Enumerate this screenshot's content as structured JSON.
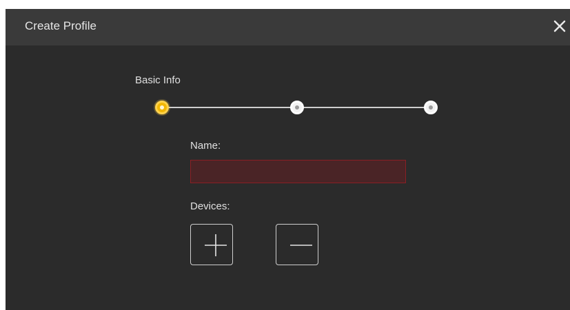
{
  "dialog": {
    "title": "Create Profile",
    "close_icon": "close-icon"
  },
  "stepper": {
    "steps": [
      {
        "label": "Basic Info",
        "state": "active"
      },
      {
        "label": "",
        "state": "inactive"
      },
      {
        "label": "",
        "state": "inactive"
      }
    ],
    "active_color": "#f2b705"
  },
  "form": {
    "name_label": "Name:",
    "name_value": "",
    "name_invalid": true,
    "devices_label": "Devices:",
    "add_device_icon": "plus-icon",
    "remove_device_icon": "minus-icon"
  },
  "colors": {
    "header_bg": "#3a3a3a",
    "body_bg": "#2b2b2b",
    "error_border": "#8a1f24",
    "error_fill": "#4a2426"
  }
}
